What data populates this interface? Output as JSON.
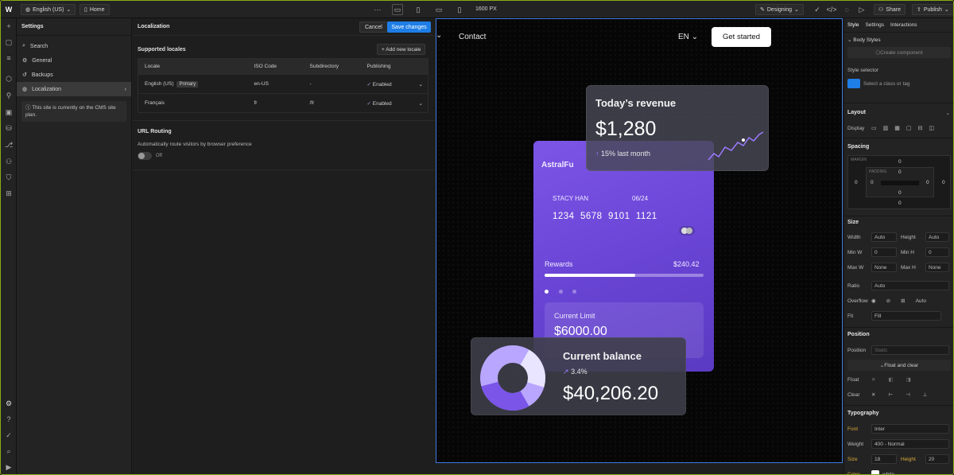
{
  "topbar": {
    "language": "English (US)",
    "page": "Home",
    "width_readout": "1600 PX",
    "mode": "Designing",
    "share": "Share",
    "publish": "Publish"
  },
  "settings": {
    "title": "Settings",
    "items": [
      {
        "label": "Search",
        "icon": "search-icon"
      },
      {
        "label": "General",
        "icon": "gear-icon"
      },
      {
        "label": "Backups",
        "icon": "backup-icon"
      },
      {
        "label": "Localization",
        "icon": "globe-icon"
      }
    ],
    "note": "This site is currently on the CMS site plan."
  },
  "localization": {
    "title": "Localization",
    "cancel": "Cancel",
    "save": "Save changes",
    "supported_title": "Supported locales",
    "add_locale": "+ Add new locale",
    "columns": [
      "Locale",
      "ISO Code",
      "Subdirectory",
      "Publishing"
    ],
    "rows": [
      {
        "locale": "English (US)",
        "badge": "Primary",
        "iso": "en-US",
        "subdir": "-",
        "status": "Enabled"
      },
      {
        "locale": "Français",
        "badge": "",
        "iso": "fr",
        "subdir": "/fr",
        "status": "Enabled"
      }
    ],
    "routing_title": "URL Routing",
    "routing_desc": "Automatically route visitors by browser preference",
    "routing_state": "Off"
  },
  "canvas": {
    "nav_contact": "Contact",
    "nav_lang": "EN",
    "cta": "Get started",
    "revenue_title": "Today’s revenue",
    "revenue_value": "$1,280",
    "revenue_change": "15% last month",
    "card_brand": "AstralFu",
    "card_name": "STACY HAN",
    "card_exp": "06/24",
    "card_number": "1234  5678  9101  1121",
    "rewards_label": "Rewards",
    "rewards_value": "$240.42",
    "rewards_progress": 0.57,
    "limit_label": "Current Limit",
    "limit_value": "$6000.00",
    "balance_title": "Current balance",
    "balance_change": "3.4%",
    "balance_value": "$40,206.20",
    "accent": "#7c55e6"
  },
  "style_panel": {
    "tabs": [
      "Style",
      "Settings",
      "Interactions"
    ],
    "body_styles": "Body Styles",
    "create_component": "Create component",
    "style_selector": "Style selector",
    "selector_placeholder": "Select a class or tag",
    "layout": "Layout",
    "display": "Display",
    "spacing": "Spacing",
    "margin": "MARGIN",
    "padding": "PADDING",
    "zero": "0",
    "size": "Size",
    "width": "Width",
    "height": "Height",
    "auto": "Auto",
    "min_w": "Min W",
    "min_h": "Min H",
    "max_w": "Max W",
    "max_h": "Max H",
    "none": "None",
    "px": "PX",
    "ratio": "Ratio",
    "overflow": "Overflow",
    "fit": "Fit",
    "fill": "Fill",
    "position": "Position",
    "position_value": "Static",
    "float_clear": "Float and clear",
    "float": "Float",
    "clear": "Clear",
    "typography": "Typography",
    "font": "Font",
    "font_value": "Inter",
    "weight": "Weight",
    "weight_value": "400 - Normal",
    "size_lbl": "Size",
    "size_value": "18",
    "height_value": "20",
    "color": "Color",
    "color_value": "white"
  }
}
